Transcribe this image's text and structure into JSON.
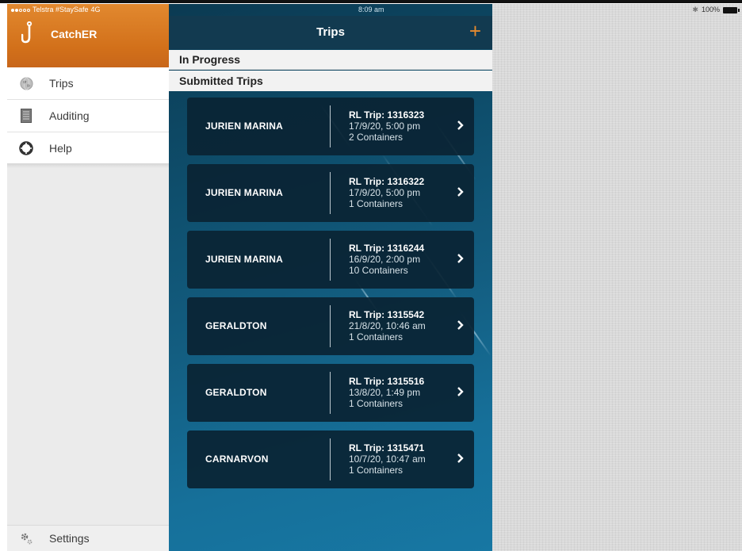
{
  "status_bar": {
    "carrier": "Telstra #StaySafe",
    "network": "4G",
    "time": "8:09 am",
    "battery": "100%"
  },
  "sidebar": {
    "app_title": "CatchER",
    "accent_color": "#d9782a",
    "items": [
      {
        "label": "Trips",
        "icon": "globe-icon"
      },
      {
        "label": "Auditing",
        "icon": "document-icon"
      },
      {
        "label": "Help",
        "icon": "lifebuoy-icon"
      }
    ],
    "settings_label": "Settings"
  },
  "navbar": {
    "title": "Trips",
    "add_label": "+"
  },
  "sections": {
    "in_progress": "In Progress",
    "submitted": "Submitted Trips"
  },
  "trips": [
    {
      "location": "JURIEN MARINA",
      "id": "RL Trip: 1316323",
      "date": "17/9/20, 5:00 pm",
      "containers": "2 Containers"
    },
    {
      "location": "JURIEN MARINA",
      "id": "RL Trip: 1316322",
      "date": "17/9/20, 5:00 pm",
      "containers": "1 Containers"
    },
    {
      "location": "JURIEN MARINA",
      "id": "RL Trip: 1316244",
      "date": "16/9/20, 2:00 pm",
      "containers": "10 Containers"
    },
    {
      "location": "GERALDTON",
      "id": "RL Trip: 1315542",
      "date": "21/8/20, 10:46 am",
      "containers": "1 Containers"
    },
    {
      "location": "GERALDTON",
      "id": "RL Trip: 1315516",
      "date": "13/8/20, 1:49 pm",
      "containers": "1 Containers"
    },
    {
      "location": "CARNARVON",
      "id": "RL Trip: 1315471",
      "date": "10/7/20, 10:47 am",
      "containers": "1 Containers"
    }
  ]
}
